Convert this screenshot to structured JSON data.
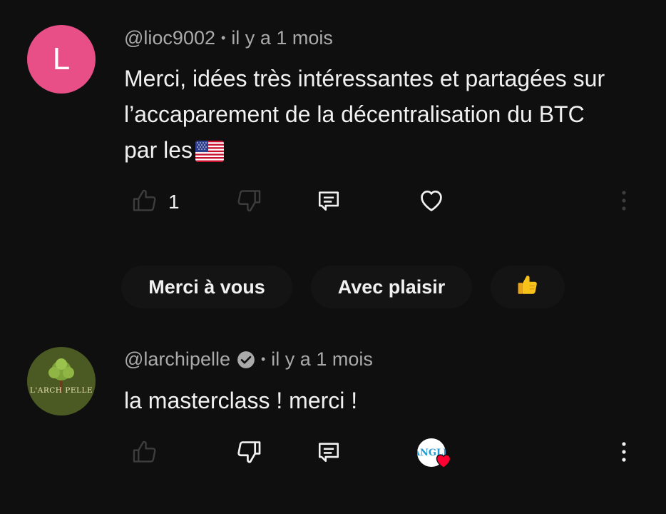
{
  "comments": [
    {
      "avatar_letter": "L",
      "avatar_color": "#e94f87",
      "handle": "@lioc9002",
      "separator": "•",
      "time": "il y a 1 mois",
      "text_lines": [
        "Merci, idées très intéressantes et partagées sur",
        "l’accaparement de la décentralisation du BTC",
        "par les"
      ],
      "flag_icon": "us-flag-emoji",
      "like_count": "1",
      "liked_by_creator": false,
      "suggested_replies": [
        "Merci à vous",
        "Avec plaisir",
        "👍"
      ]
    },
    {
      "avatar_logo_text": "L'ARCH PELLE",
      "avatar_color": "#4b5a22",
      "handle": "@larchipelle",
      "verified": true,
      "separator": "•",
      "time": "il y a 1 mois",
      "text": "la masterclass ! merci !",
      "like_count": "",
      "liked_by_creator": true,
      "creator_avatar_text": "ANGLE",
      "heart_color": "#ff0033"
    }
  ],
  "colors": {
    "background": "#0f0f0f",
    "text_primary": "#f1f1f1",
    "text_secondary": "#aaaaaa",
    "icon_dim": "#3d3d3d"
  }
}
